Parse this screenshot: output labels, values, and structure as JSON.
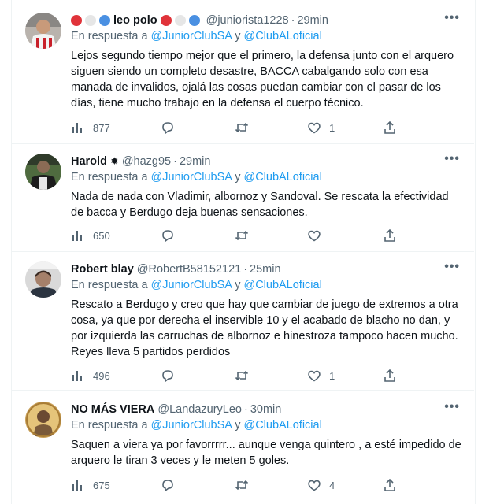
{
  "tweets": [
    {
      "emoji_prefix": [
        "#e0333a",
        "#e6e6e6",
        "#4a90e2"
      ],
      "name": "leo polo",
      "emoji_suffix": [
        "#e0333a",
        "#e6e6e6",
        "#4a90e2"
      ],
      "handle": "@juniorista1228",
      "time": "29min",
      "reply_prefix": "En respuesta a",
      "mention_1": "@JuniorClubSA",
      "reply_join": "y",
      "mention_2": "@ClubALoficial",
      "text": "Lejos segundo tiempo mejor que el primero, la defensa junto con el arquero siguen siendo un completo desastre, BACCA cabalgando solo con esa manada de invalidos, ojalá las cosas puedan cambiar con el pasar de los días, tiene mucho trabajo en la defensa el cuerpo técnico.",
      "views": "877",
      "likes": "1"
    },
    {
      "name": "Harold",
      "handle": "@hazg95",
      "time": "29min",
      "reply_prefix": "En respuesta a",
      "mention_1": "@JuniorClubSA",
      "reply_join": "y",
      "mention_2": "@ClubALoficial",
      "text": "Nada de nada  con Vladimir, albornoz y Sandoval. Se rescata la efectividad de bacca y Berdugo deja buenas sensaciones.",
      "views": "650",
      "likes": ""
    },
    {
      "name": "Robert blay",
      "handle": "@RobertB58152121",
      "time": "25min",
      "reply_prefix": "En respuesta a",
      "mention_1": "@JuniorClubSA",
      "reply_join": "y",
      "mention_2": "@ClubALoficial",
      "text": "Rescato a Berdugo y creo que hay que cambiar de juego de extremos a otra cosa, ya que por derecha el inservible 10 y el acabado de blacho no dan, y por izquierda las carruchas de albornoz e hinestroza tampoco hacen mucho. Reyes lleva 5 partidos perdidos",
      "views": "496",
      "likes": "1"
    },
    {
      "name": "NO MÁS VIERA",
      "handle": "@LandazuryLeo",
      "time": "30min",
      "reply_prefix": "En respuesta a",
      "mention_1": "@JuniorClubSA",
      "reply_join": "y",
      "mention_2": "@ClubALoficial",
      "text": "Saquen a viera ya por favorrrrr... aunque venga quintero , a esté impedido de arquero le tiran 3 veces y le meten 5 goles.",
      "views": "675",
      "likes": "4"
    }
  ],
  "more_label": "•••",
  "dot": "·",
  "colors": {
    "accent": "#1d9bf0",
    "muted": "#536471",
    "text": "#0f1419"
  },
  "icons": [
    "views-icon",
    "reply-icon",
    "retweet-icon",
    "like-icon",
    "share-icon",
    "more-icon",
    "verified-sun-icon"
  ]
}
